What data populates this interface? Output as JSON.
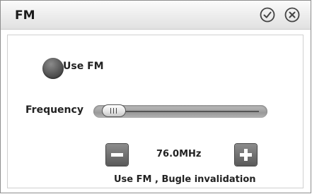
{
  "window": {
    "title": "FM"
  },
  "titlebar": {
    "confirm_icon": "check-circle-icon",
    "close_icon": "close-circle-icon"
  },
  "fm_toggle": {
    "label": "Use FM",
    "checked": false
  },
  "frequency": {
    "label": "Frequency",
    "value_display": "76.0MHz",
    "slider_fraction": 0.0,
    "decrease_icon": "minus-icon",
    "increase_icon": "plus-icon"
  },
  "status": {
    "text": "Use FM , Bugle invalidation"
  }
}
